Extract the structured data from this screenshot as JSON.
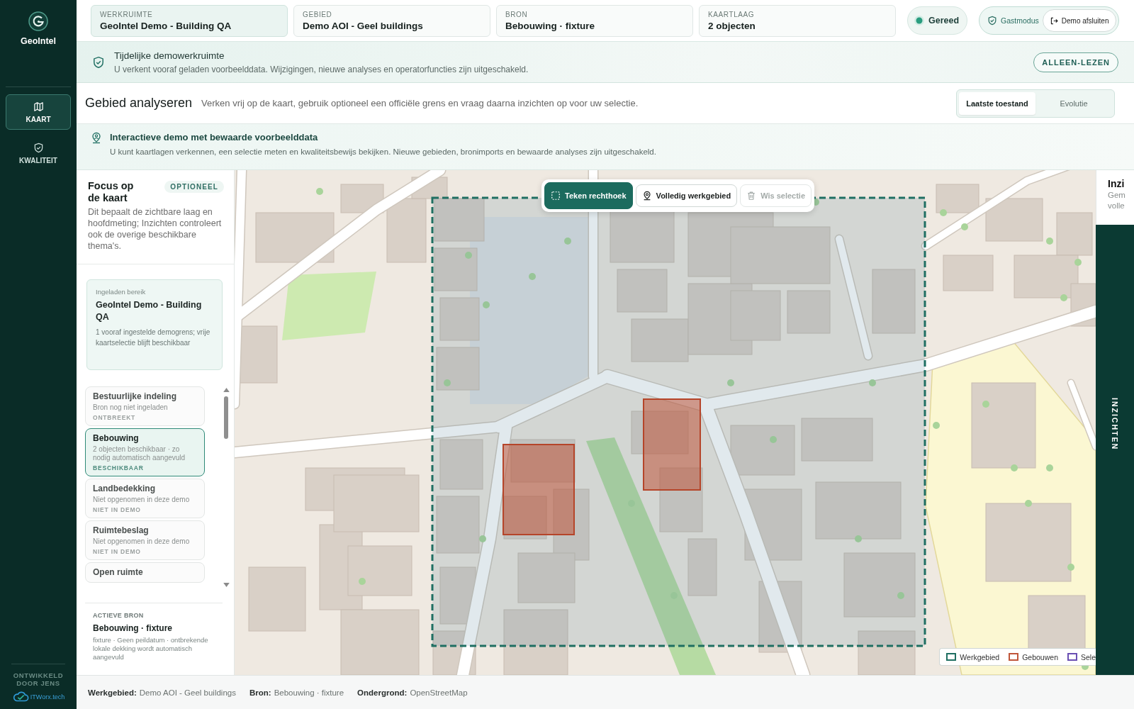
{
  "sidebar": {
    "brand": "GeoIntel",
    "nav": [
      {
        "label": "KAART",
        "selected": true
      },
      {
        "label": "KWALITEIT",
        "selected": false
      }
    ],
    "credit": "ONTWIKKELD DOOR JENS",
    "partner": "ITWorx.tech"
  },
  "context_cards": [
    {
      "label": "WERKRUIMTE",
      "value": "GeoIntel Demo - Building QA",
      "selected": true
    },
    {
      "label": "GEBIED",
      "value": "Demo AOI - Geel buildings",
      "selected": false
    },
    {
      "label": "BRON",
      "value": "Bebouwing · fixture",
      "selected": false
    },
    {
      "label": "KAARTLAAG",
      "value": "2 objecten",
      "selected": false
    }
  ],
  "status": {
    "label": "Gereed",
    "ready": true
  },
  "guest": {
    "label": "Gastmodus",
    "button": "Demo afsluiten"
  },
  "demo_banner": {
    "title": "Tijdelijke demowerkruimte",
    "text": "U verkent vooraf geladen voorbeelddata. Wijzigingen, nieuwe analyses en operatorfuncties zijn uitgeschakeld.",
    "badge": "ALLEEN-LEZEN"
  },
  "page_header": {
    "title": "Gebied analyseren",
    "description": "Verken vrij op de kaart, gebruik optioneel een officiële grens en vraag daarna inzichten op voor uw selectie.",
    "view_tabs": [
      {
        "label": "Laatste toestand",
        "selected": true
      },
      {
        "label": "Evolutie",
        "selected": false
      }
    ]
  },
  "info_banner": {
    "title": "Interactieve demo met bewaarde voorbeelddata",
    "text": "U kunt kaartlagen verkennen, een selectie meten en kwaliteitsbewijs bekijken. Nieuwe gebieden, bronimports en bewaarde analyses zijn uitgeschakeld."
  },
  "focus_panel": {
    "title": "Focus op de kaart",
    "badge": "OPTIONEEL",
    "description": "Dit bepaalt de zichtbare laag en hoofdmeting; Inzichten controleert ook de overige beschikbare thema's.",
    "loaded_range": {
      "label": "Ingeladen bereik",
      "title": "GeoIntel Demo - Building QA",
      "text": "1 vooraf ingestelde demogrens; vrije kaartselectie blijft beschikbaar"
    },
    "themes": [
      {
        "title": "Bestuurlijke indeling",
        "text": "Bron nog niet ingeladen",
        "status": "ONTBREEKT",
        "selected": false
      },
      {
        "title": "Bebouwing",
        "text": "2 objecten beschikbaar · zo nodig automatisch aangevuld",
        "status": "BESCHIKBAAR",
        "selected": true
      },
      {
        "title": "Landbedekking",
        "text": "Niet opgenomen in deze demo",
        "status": "NIET IN DEMO",
        "selected": false
      },
      {
        "title": "Ruimtebeslag",
        "text": "Niet opgenomen in deze demo",
        "status": "NIET IN DEMO",
        "selected": false
      },
      {
        "title": "Open ruimte",
        "selected": false
      }
    ],
    "active_source": {
      "label": "ACTIEVE BRON",
      "title": "Bebouwing · fixture",
      "text": "fixture · Geen peildatum · ontbrekende lokale dekking wordt automatisch aangevuld"
    }
  },
  "map": {
    "tools": [
      {
        "label": "Teken rechthoek",
        "kind": "primary",
        "disabled": false
      },
      {
        "label": "Volledig werkgebied",
        "kind": "secondary",
        "disabled": false
      },
      {
        "label": "Wis selectie",
        "kind": "secondary",
        "disabled": true
      }
    ],
    "legend": [
      {
        "label": "Werkgebied",
        "color": "#1f6f62"
      },
      {
        "label": "Gebouwen",
        "color": "#c0563a"
      },
      {
        "label": "Sele",
        "color": "#6a4fb3"
      }
    ]
  },
  "insights_panel": {
    "title": "Inzi",
    "lines": [
      "Gem",
      "volle"
    ],
    "tab": "INZICHTEN"
  },
  "status_bar": [
    {
      "label": "Werkgebied:",
      "value": "Demo AOI - Geel buildings"
    },
    {
      "label": "Bron:",
      "value": "Bebouwing · fixture"
    },
    {
      "label": "Ondergrond:",
      "value": "OpenStreetMap"
    }
  ]
}
